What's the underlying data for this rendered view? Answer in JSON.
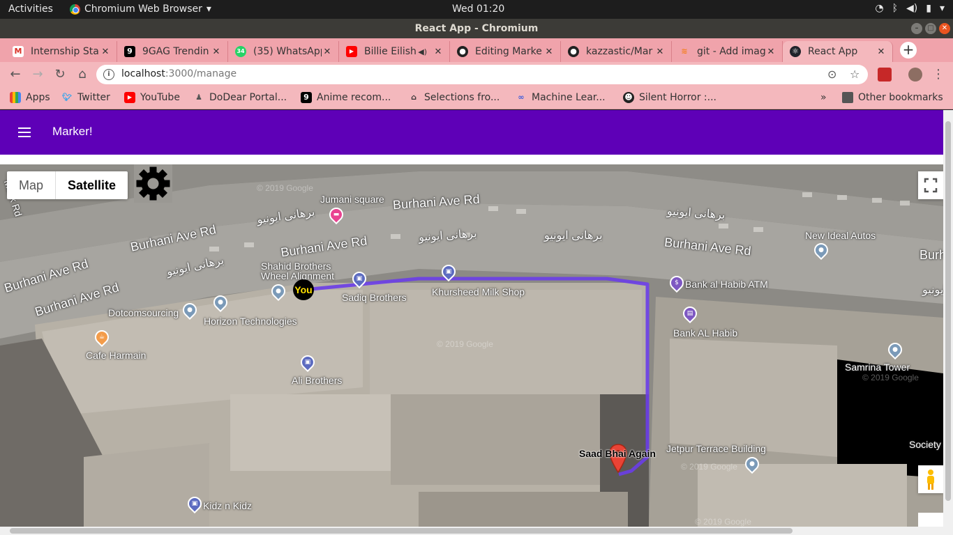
{
  "system": {
    "activities": "Activities",
    "app_name": "Chromium Web Browser",
    "clock": "Wed 01:20"
  },
  "window": {
    "title": "React App - Chromium"
  },
  "tabs": [
    {
      "label": "Internship Sta",
      "icon": "gmail-icon"
    },
    {
      "label": "9GAG Trendin",
      "icon": "9gag-icon"
    },
    {
      "label": "(35) WhatsApp",
      "icon": "whatsapp-icon",
      "badge": "34"
    },
    {
      "label": "Billie Eilish",
      "icon": "youtube-icon"
    },
    {
      "label": "Editing Marke",
      "icon": "github-icon"
    },
    {
      "label": "kazzastic/Mar",
      "icon": "github-icon"
    },
    {
      "label": "git - Add imag",
      "icon": "stackoverflow-icon"
    },
    {
      "label": "React App",
      "icon": "react-icon"
    }
  ],
  "address": {
    "host": "localhost",
    "path": ":3000/manage"
  },
  "bookmarks": [
    {
      "label": "Apps"
    },
    {
      "label": "Twitter"
    },
    {
      "label": "YouTube"
    },
    {
      "label": "DoDear Portal..."
    },
    {
      "label": "Anime recom..."
    },
    {
      "label": "Selections fro..."
    },
    {
      "label": "Machine Lear..."
    },
    {
      "label": "Silent Horror :..."
    }
  ],
  "bookmarks_overflow": "»",
  "other_bookmarks": "Other bookmarks",
  "app": {
    "title": "Marker!"
  },
  "map": {
    "type_buttons": {
      "map": "Map",
      "satellite": "Satellite"
    },
    "roads": [
      "Malik Rd",
      "Burhani Ave Rd",
      "Burhani Ave Rd",
      "Burhani Ave Rd",
      "Burhani Ave Rd",
      "Burhani Ave Rd",
      "Burhani Ave Rd",
      "Burh",
      "برھانی ایونیو",
      "برھانی ایونیو",
      "برھانی ایونیو",
      "برھانی ایونیو",
      "برھانی ایونیو",
      "برھانی ایونیو"
    ],
    "pois": {
      "jumani": "Jumani square",
      "shahid": "Shahid Brothers Wheel Alignment",
      "sadiq": "Sadiq Brothers",
      "khursheed": "Khursheed Milk Shop",
      "bank_atm": "Bank al Habib ATM",
      "bank": "Bank AL Habib",
      "new_ideal": "New Ideal Autos",
      "dotcom": "Dotcomsourcing",
      "horizon": "Horizon Technologies",
      "cafe": "Cafe Harmain",
      "ali": "Ali Brothers",
      "samrina": "Samrina Tower",
      "jetpur": "Jetpur Terrace Building",
      "society": "Society",
      "kidz": "Kidz n Kidz"
    },
    "watermark": "© 2019 Google",
    "you_label": "You",
    "destination_label": "Saad Bhai Again",
    "route_color": "#6a3de8"
  }
}
